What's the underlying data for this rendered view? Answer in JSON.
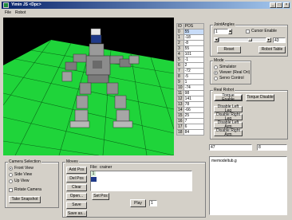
{
  "window": {
    "title": "Yimin JS <Dpc>",
    "minimize": "_",
    "maximize": "□",
    "close": "×"
  },
  "menu": [
    "File",
    "Robot"
  ],
  "joint_table": {
    "headers": [
      "ID",
      "POS"
    ],
    "rows": [
      [
        "0",
        "55"
      ],
      [
        "1",
        "-18"
      ],
      [
        "2",
        "-8"
      ],
      [
        "3",
        "55"
      ],
      [
        "4",
        "101"
      ],
      [
        "5",
        "-1"
      ],
      [
        "6",
        "2"
      ],
      [
        "7",
        "-72"
      ],
      [
        "8",
        "-5"
      ],
      [
        "9",
        "1"
      ],
      [
        "10",
        "-74"
      ],
      [
        "11",
        "98"
      ],
      [
        "12",
        "141"
      ],
      [
        "13",
        "78"
      ],
      [
        "14",
        "-66"
      ],
      [
        "15",
        "25"
      ],
      [
        "16",
        "7"
      ],
      [
        "17",
        "6"
      ],
      [
        "18",
        "84"
      ]
    ]
  },
  "joint_angles": {
    "legend": "JointAngles",
    "spin_value": "1",
    "cursor_enable": "Cursor Enable",
    "slider_value": "43",
    "reset": "Reset",
    "robot_table": "Robot Table"
  },
  "mode": {
    "legend": "Mode",
    "options": [
      "Simulator",
      "Viewer (Real Ori)",
      "Servo Control"
    ],
    "selected": 1
  },
  "real_robot": {
    "legend": "Real Robot",
    "torque_enable": "Torque Enable",
    "torque_disable": "Torque Disable",
    "disable_left_leg": "Disable Left Leg",
    "disable_right_leg": "Disable Right Leg",
    "disable_left_arm": "Disable Left Arm",
    "disable_right_arm": "Disable Right Arm"
  },
  "readouts": {
    "a": "47",
    "b": "8"
  },
  "log": {
    "text": "memodeltub.g"
  },
  "camera": {
    "legend": "Camera Selection",
    "options": [
      "Front View",
      "Side View",
      "Up View"
    ],
    "selected": 0,
    "rotate_camera": "Rotate Camera",
    "snapshot": "Take Snapshot"
  },
  "moves": {
    "legend": "Moves",
    "add_pos": "Add Pos",
    "del_pos": "Del Pos",
    "clear": "Clear",
    "open": "Open...",
    "save": "Save",
    "save_as": "Save as...",
    "set_pos": "Set Pos",
    "file_label": "File:",
    "file_name": "crainer",
    "seq_index": "1",
    "play": "Play",
    "play_value": "1"
  },
  "colors": {
    "floor": "#1fd43a",
    "robot_head_blue": "#1f3a8a"
  }
}
